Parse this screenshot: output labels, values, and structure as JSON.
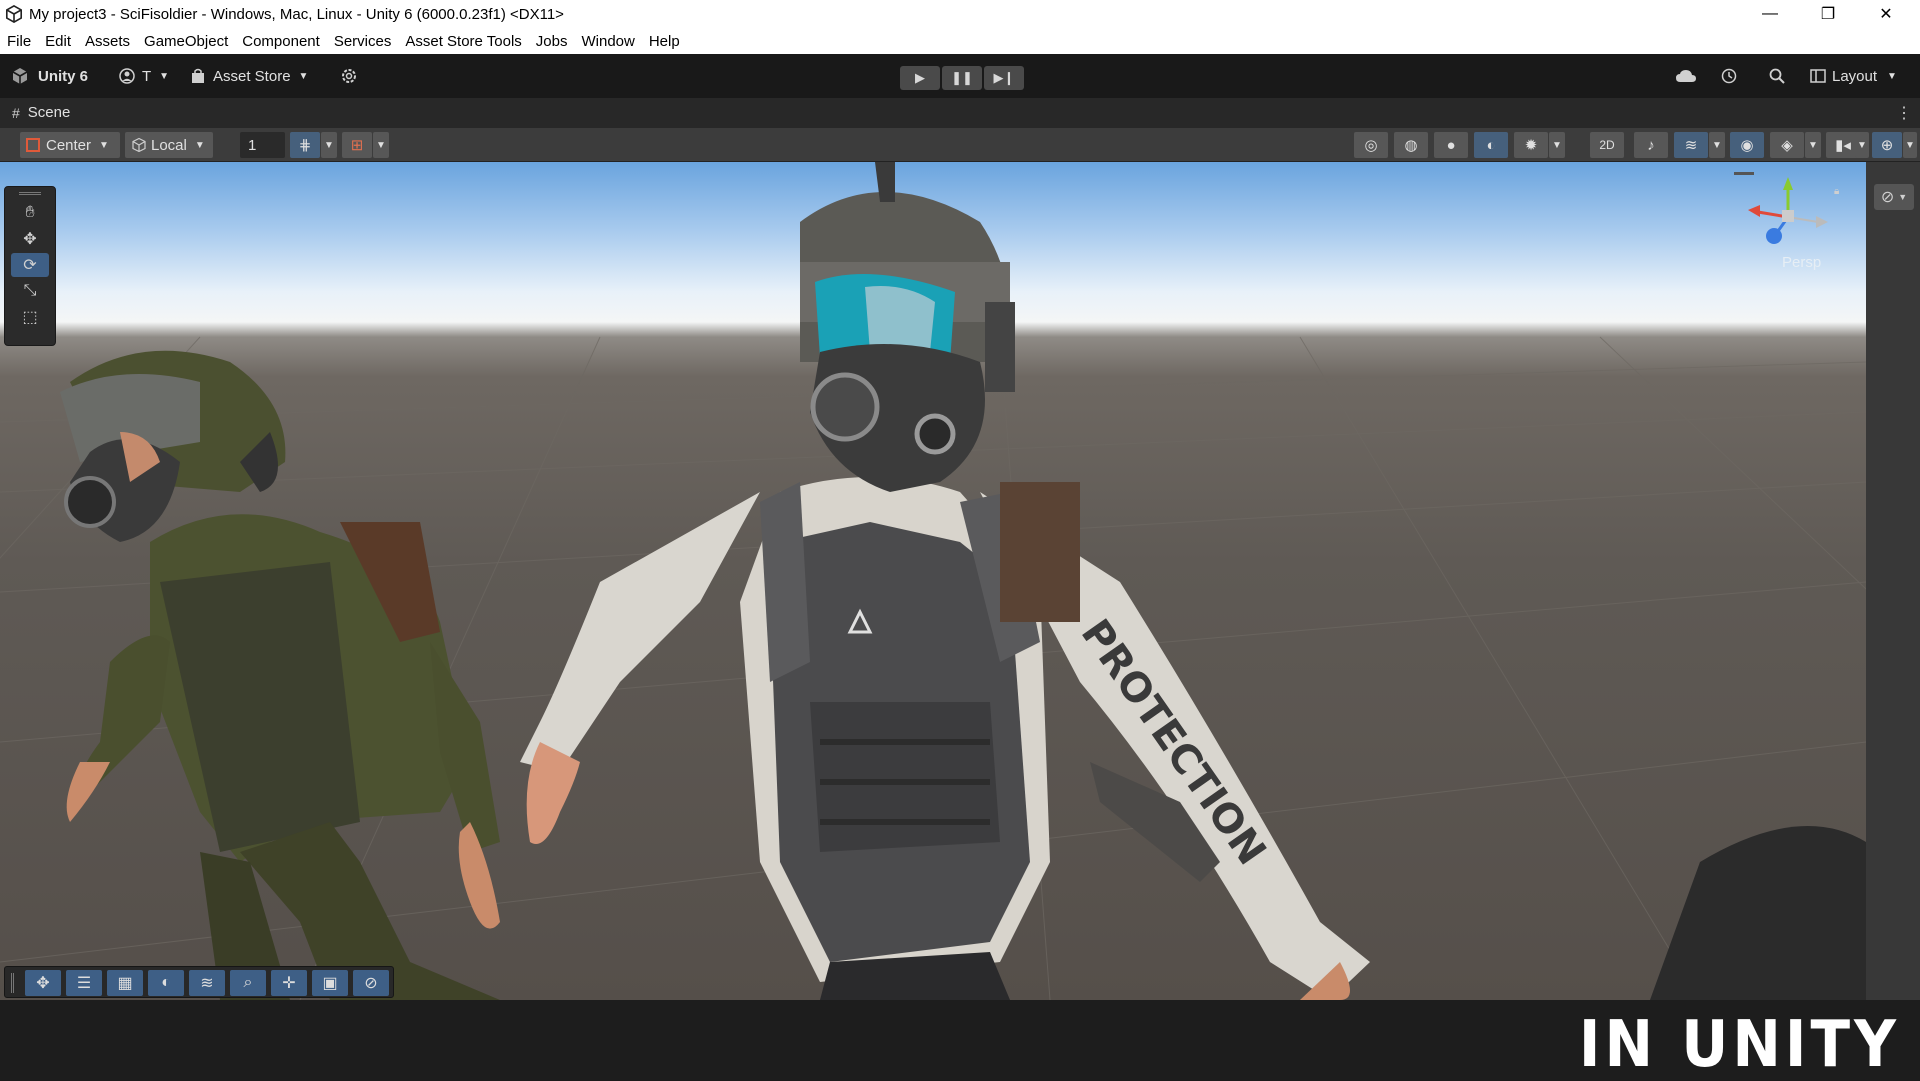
{
  "window": {
    "title": "My project3 - SciFisoldier - Windows, Mac, Linux - Unity 6 (6000.0.23f1) <DX11>",
    "minimize": "—",
    "maximize": "❐",
    "close": "✕"
  },
  "menu": [
    "File",
    "Edit",
    "Assets",
    "GameObject",
    "Component",
    "Services",
    "Asset Store Tools",
    "Jobs",
    "Window",
    "Help"
  ],
  "toolbar": {
    "unity_label": "Unity 6",
    "account_label": "T",
    "asset_store_label": "Asset Store",
    "layout_label": "Layout"
  },
  "scene_tab": {
    "label": "Scene"
  },
  "scene_toolbar": {
    "pivot_label": "Center",
    "space_label": "Local",
    "grid_value": "1"
  },
  "gizmo": {
    "projection_label": "Persp"
  },
  "watermark": "IN UNITY",
  "colors": {
    "accent": "#3e5f86",
    "editor_bg": "#3c3c3c",
    "toolbar_bg": "#191919"
  }
}
